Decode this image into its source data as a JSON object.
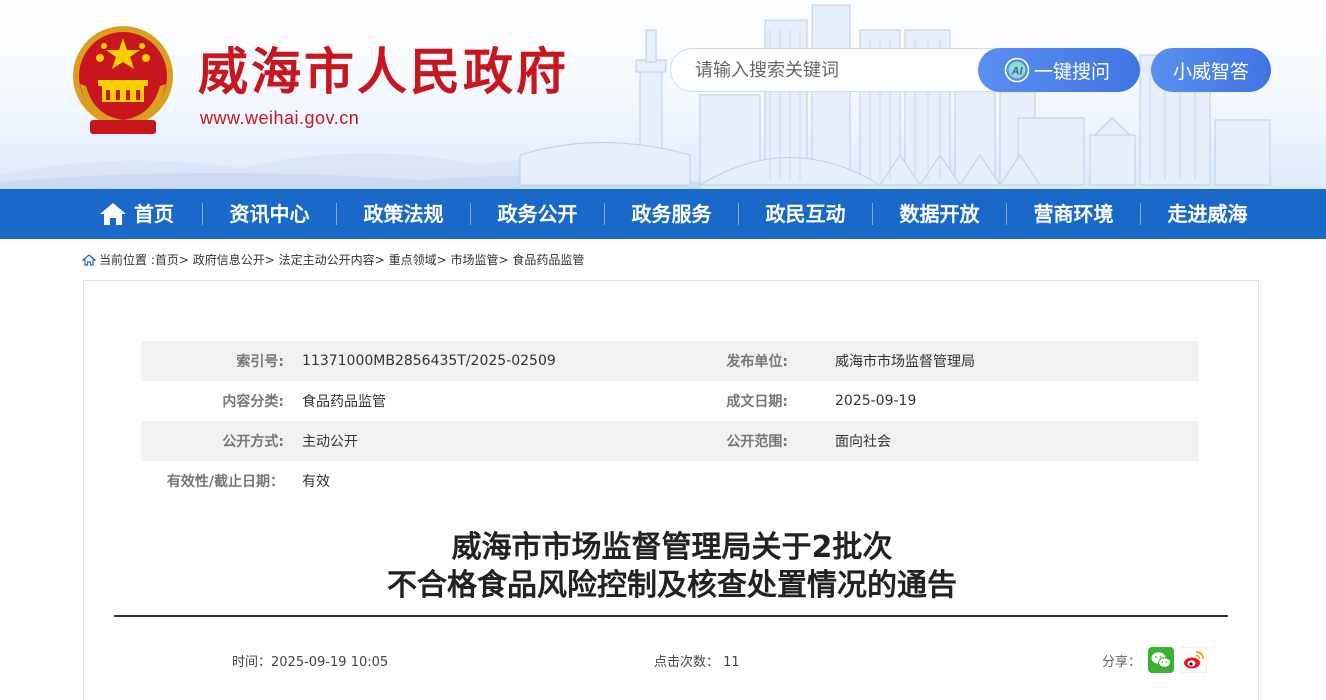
{
  "header": {
    "site_title": "威海市人民政府",
    "site_url": "www.weihai.gov.cn",
    "search_placeholder": "请输入搜索关键词",
    "ai_search_label": "一键搜问",
    "ai_icon_text": "AI",
    "assistant_label": "小威智答"
  },
  "nav": {
    "items": [
      {
        "label": "首页",
        "icon": "home-icon"
      },
      {
        "label": "资讯中心"
      },
      {
        "label": "政策法规"
      },
      {
        "label": "政务公开"
      },
      {
        "label": "政务服务"
      },
      {
        "label": "政民互动"
      },
      {
        "label": "数据开放"
      },
      {
        "label": "营商环境"
      },
      {
        "label": "走进威海"
      }
    ]
  },
  "breadcrumb": {
    "prefix": "当前位置 :",
    "items": [
      "首页",
      "政府信息公开",
      "法定主动公开内容",
      "重点领域",
      "市场监管",
      "食品药品监管"
    ],
    "separator": ">"
  },
  "meta": {
    "index_label": "索引号:",
    "index_value": "11371000MB2856435T/2025-02509",
    "publisher_label": "发布单位:",
    "publisher_value": "威海市市场监督管理局",
    "category_label": "内容分类:",
    "category_value": "食品药品监管",
    "date_label": "成文日期:",
    "date_value": "2025-09-19",
    "method_label": "公开方式:",
    "method_value": "主动公开",
    "scope_label": "公开范围:",
    "scope_value": "面向社会",
    "validity_label": "有效性/截止日期：",
    "validity_value": "有效"
  },
  "article": {
    "title_line1": "威海市市场监督管理局关于2批次",
    "title_line2": "不合格食品风险控制及核查处置情况的通告",
    "time_label": "时间：",
    "time_value": "2025-09-19 10:05",
    "views_label": "点击次数：",
    "views_value": "11",
    "share_label": "分享："
  },
  "colors": {
    "brand_red": "#c8161e",
    "nav_blue": "#1a68c8",
    "button_blue": "#4a7fe8"
  }
}
